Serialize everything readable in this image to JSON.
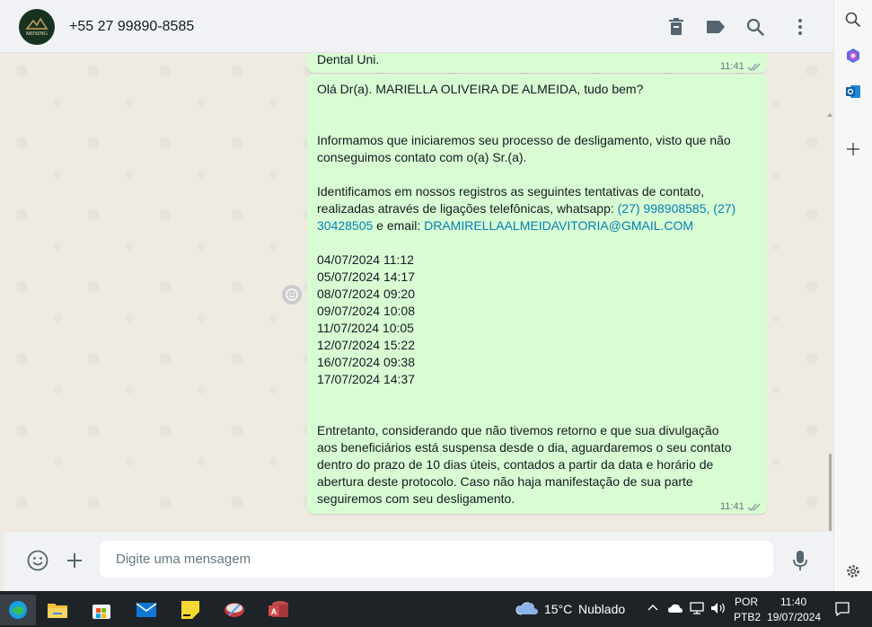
{
  "header": {
    "avatar_text": "MINING",
    "contact": "+55 27 99890-8585",
    "icons": [
      "delete-icon",
      "label-icon",
      "search-icon",
      "more-icon"
    ]
  },
  "messages": {
    "top": {
      "text": "Dental Uni.",
      "time": "11:41"
    },
    "main": {
      "greeting": "Olá Dr(a). MARIELLA OLIVEIRA DE ALMEIDA, tudo bem?",
      "para1": "Informamos que iniciaremos seu processo de desligamento, visto que não conseguimos contato com o(a) Sr.(a).",
      "para2_before": "Identificamos em nossos registros as seguintes tentativas de contato, realizadas através de ligações telefônicas, whatsapp: ",
      "phone_link": "(27) 998908585, (27) 30428505",
      "para2_mid": " e email: ",
      "email_link": "DRAMIRELLAALMEIDAVITORIA@GMAIL.COM",
      "dates": [
        "04/07/2024 11:12",
        "05/07/2024 14:17",
        "08/07/2024 09:20",
        "09/07/2024 10:08",
        "11/07/2024 10:05",
        "12/07/2024 15:22",
        "16/07/2024 09:38",
        "17/07/2024 14:37"
      ],
      "para3": "Entretanto, considerando que não tivemos retorno e que sua divulgação aos beneficiários está suspensa desde o dia, aguardaremos o seu contato dentro do prazo de 10 dias úteis, contados a partir da data e horário de abertura deste protocolo. Caso não haja manifestação de sua parte seguiremos com seu desligamento.",
      "time": "11:41"
    }
  },
  "composer": {
    "placeholder": "Digite uma mensagem"
  },
  "sidebar": {
    "icons": [
      "search-icon",
      "copilot-icon",
      "outlook-icon",
      "add-icon",
      "settings-icon"
    ]
  },
  "taskbar": {
    "weather_temp": "15°C",
    "weather_desc": "Nublado",
    "lang": "POR",
    "layout": "PTB2",
    "time": "11:40",
    "date": "19/07/2024"
  },
  "colors": {
    "bubble": "#d9fdd3",
    "link": "#027eb5",
    "header": "#f0f2f5"
  }
}
